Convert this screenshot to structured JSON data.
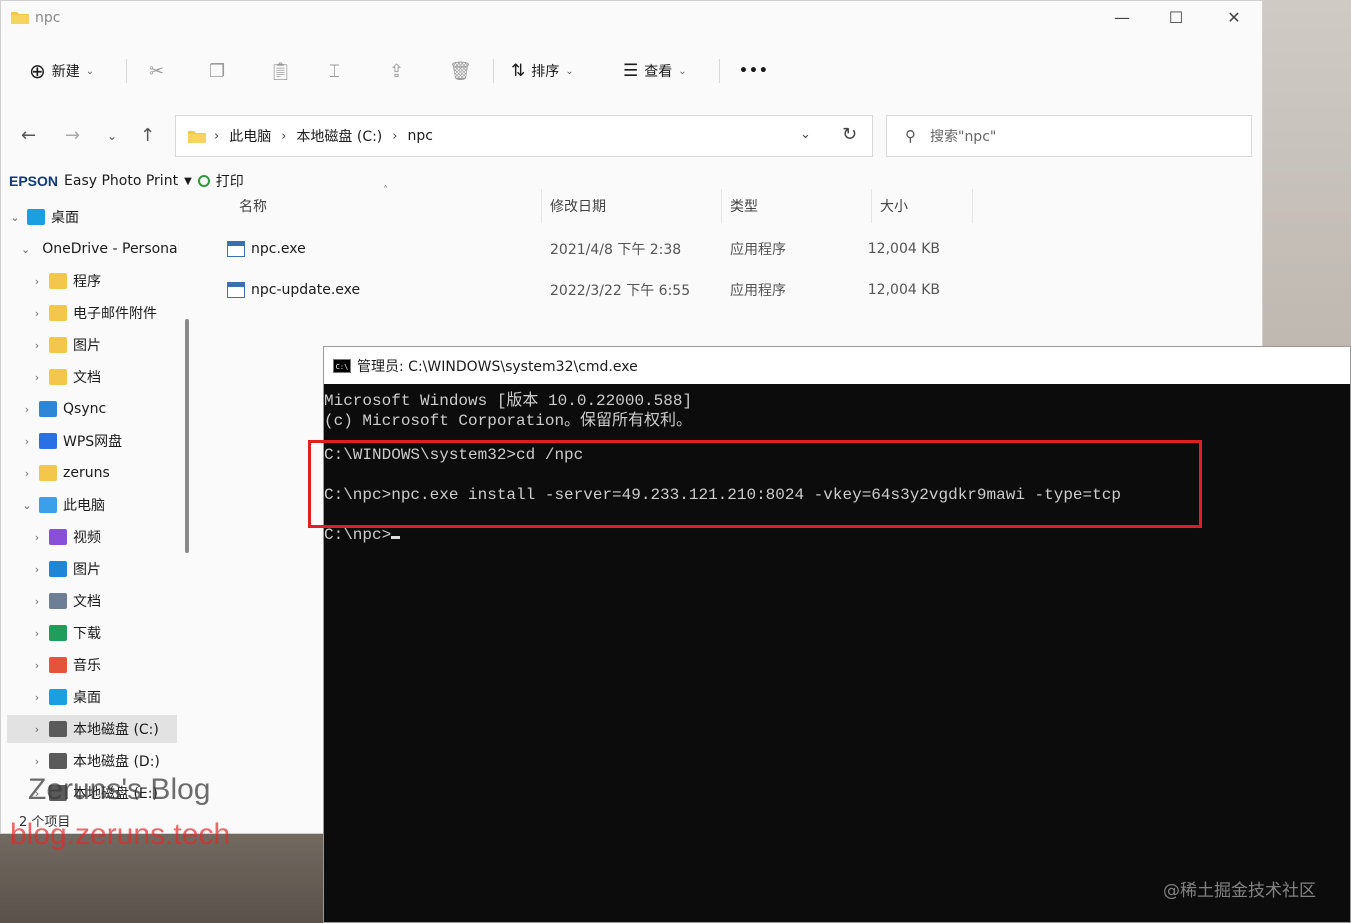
{
  "explorer": {
    "window_title": "npc",
    "toolbar": {
      "new_label": "新建",
      "sort_label": "排序",
      "view_label": "查看",
      "more_label": "•••"
    },
    "breadcrumb": [
      "此电脑",
      "本地磁盘 (C:)",
      "npc"
    ],
    "search_placeholder": "搜索\"npc\"",
    "epson": {
      "brand": "EPSON",
      "app": "Easy Photo Print",
      "print_label": "打印"
    },
    "sidebar": [
      {
        "label": "桌面",
        "indent": 0,
        "expanded": true,
        "icon": "desktop-icon",
        "color": "#1aa0e0"
      },
      {
        "label": "OneDrive - Personal",
        "indent": 1,
        "expanded": true,
        "icon": "onedrive-icon",
        "color": "#1e74d8"
      },
      {
        "label": "程序",
        "indent": 2,
        "expanded": false,
        "icon": "folder-icon",
        "color": "#f3c74a"
      },
      {
        "label": "电子邮件附件",
        "indent": 2,
        "expanded": false,
        "icon": "folder-icon",
        "color": "#f3c74a"
      },
      {
        "label": "图片",
        "indent": 2,
        "expanded": false,
        "icon": "folder-icon",
        "color": "#f3c74a"
      },
      {
        "label": "文档",
        "indent": 2,
        "expanded": false,
        "icon": "folder-icon",
        "color": "#f3c74a"
      },
      {
        "label": "Qsync",
        "indent": 1,
        "expanded": false,
        "icon": "qsync-icon",
        "color": "#2f86d6"
      },
      {
        "label": "WPS网盘",
        "indent": 1,
        "expanded": false,
        "icon": "cloud-icon",
        "color": "#2b6fe6"
      },
      {
        "label": "zeruns",
        "indent": 1,
        "expanded": false,
        "icon": "folder-icon",
        "color": "#f3c74a"
      },
      {
        "label": "此电脑",
        "indent": 1,
        "expanded": true,
        "icon": "computer-icon",
        "color": "#3aa0e8"
      },
      {
        "label": "视频",
        "indent": 2,
        "expanded": false,
        "icon": "video-icon",
        "color": "#8a4fd8"
      },
      {
        "label": "图片",
        "indent": 2,
        "expanded": false,
        "icon": "pictures-icon",
        "color": "#1e86d6"
      },
      {
        "label": "文档",
        "indent": 2,
        "expanded": false,
        "icon": "documents-icon",
        "color": "#6e7f95"
      },
      {
        "label": "下载",
        "indent": 2,
        "expanded": false,
        "icon": "download-icon",
        "color": "#1e9e5a"
      },
      {
        "label": "音乐",
        "indent": 2,
        "expanded": false,
        "icon": "music-icon",
        "color": "#e5533d"
      },
      {
        "label": "桌面",
        "indent": 2,
        "expanded": false,
        "icon": "desktop-icon",
        "color": "#1aa0e0"
      },
      {
        "label": "本地磁盘 (C:)",
        "indent": 2,
        "expanded": false,
        "icon": "drive-c-icon",
        "color": "#5a5a5a",
        "selected": true
      },
      {
        "label": "本地磁盘 (D:)",
        "indent": 2,
        "expanded": false,
        "icon": "drive-icon",
        "color": "#5a5a5a"
      },
      {
        "label": "本地磁盘 (E:)",
        "indent": 2,
        "expanded": false,
        "icon": "drive-icon",
        "color": "#5a5a5a"
      }
    ],
    "columns": [
      "名称",
      "修改日期",
      "类型",
      "大小"
    ],
    "files": [
      {
        "name": "npc.exe",
        "date": "2021/4/8 下午 2:38",
        "type": "应用程序",
        "size": "12,004 KB"
      },
      {
        "name": "npc-update.exe",
        "date": "2022/3/22 下午 6:55",
        "type": "应用程序",
        "size": "12,004 KB"
      }
    ],
    "status": "2 个项目"
  },
  "cmd": {
    "title": "管理员: C:\\WINDOWS\\system32\\cmd.exe",
    "icon_text": "C:\\",
    "lines": [
      "Microsoft Windows [版本 10.0.22000.588]",
      "(c) Microsoft Corporation。保留所有权利。",
      "",
      "C:\\WINDOWS\\system32>cd /npc",
      "",
      "C:\\npc>npc.exe install -server=49.233.121.210:8024 -vkey=64s3y2vgdkr9mawi -type=tcp",
      "",
      "C:\\npc>"
    ]
  },
  "watermarks": {
    "blog_name": "Zeruns's Blog",
    "blog_url": "blog.zeruns.tech",
    "site": "@稀土掘金技术社区"
  },
  "colors": {
    "highlight": "#e02020",
    "cmd_bg": "#0c0c0c",
    "cmd_text": "#cccccc"
  }
}
